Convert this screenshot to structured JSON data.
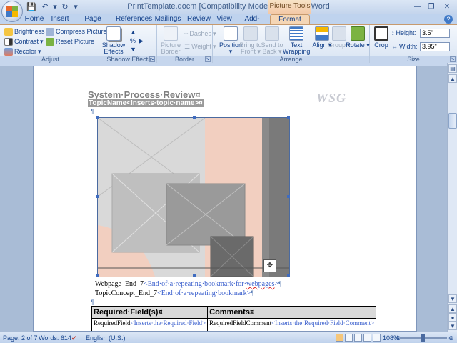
{
  "window": {
    "title": "PrintTemplate.docm [Compatibility Mode] - Microsoft Word",
    "contextual_tab_group": "Picture Tools"
  },
  "tabs": [
    "Home",
    "Insert",
    "Page Layout",
    "References",
    "Mailings",
    "Review",
    "View",
    "Add-Ins",
    "Format"
  ],
  "active_tab": "Format",
  "ribbon": {
    "adjust": {
      "label": "Adjust",
      "brightness": "Brightness",
      "contrast": "Contrast",
      "recolor": "Recolor",
      "compress": "Compress Pictures",
      "reset": "Reset Picture"
    },
    "shadow_effects": {
      "label": "Shadow Effects",
      "button": "Shadow Effects"
    },
    "border": {
      "label": "Border",
      "picture_border": "Picture Border",
      "dashes": "Dashes",
      "weight": "Weight"
    },
    "arrange": {
      "label": "Arrange",
      "position": "Position",
      "bring_to_front": "Bring to Front",
      "send_to_back": "Send to Back",
      "text_wrapping": "Text Wrapping",
      "align": "Align",
      "group": "Group",
      "rotate": "Rotate"
    },
    "size": {
      "label": "Size",
      "crop": "Crop",
      "height_label": "Height:",
      "height_value": "3.5\"",
      "width_label": "Width:",
      "width_value": "3.95\""
    }
  },
  "document": {
    "title": "System·Process·Review¤",
    "topic": "TopicName<Inserts·topic·name>¤",
    "logo": "WSG",
    "bookmark_1": {
      "text": "Webpage_End_7",
      "comment": "<End·of·a·repeating·bookmark·for·",
      "comment_red": "webpages",
      "comment_end": ">"
    },
    "bookmark_2": {
      "text": "TopicConcept_End_7",
      "comment": "<End·of·a·repeating·bookmark>"
    },
    "table": {
      "headers": [
        "Required·Field(s)¤",
        "Comments¤"
      ],
      "rows": [
        {
          "field": "RequiredField",
          "field_note": "<Inserts·the·Required·Field>",
          "comment": "RequiredFieldComment",
          "comment_note": "<Inserts·the·Required·Field·Comment>"
        }
      ]
    }
  },
  "status": {
    "page": "Page: 2 of 7",
    "words": "Words: 614",
    "language": "English (U.S.)",
    "zoom": "108%"
  }
}
